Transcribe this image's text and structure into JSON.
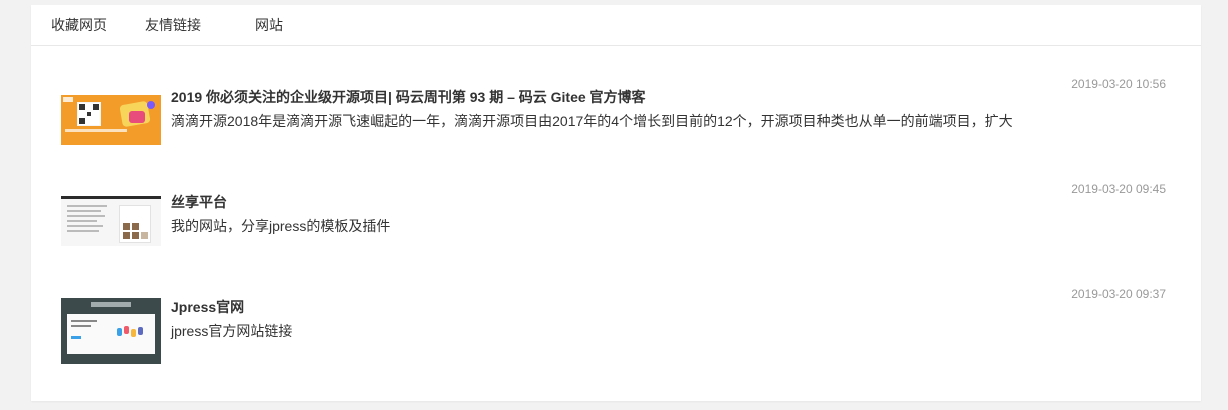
{
  "tabs": [
    {
      "label": "收藏网页"
    },
    {
      "label": "友情链接"
    },
    {
      "label": "网站"
    }
  ],
  "items": [
    {
      "title": "2019 你必须关注的企业级开源项目| 码云周刊第 93 期 – 码云 Gitee 官方博客",
      "description": "滴滴开源2018年是滴滴开源飞速崛起的一年，滴滴开源项目由2017年的4个增长到目前的12个，开源项目种类也从单一的前端项目，扩大",
      "date": "2019-03-20 10:56",
      "thumbnail": "gitee-weekly-banner"
    },
    {
      "title": "丝享平台",
      "description": "我的网站，分享jpress的模板及插件",
      "date": "2019-03-20 09:45",
      "thumbnail": "sixiang-site-screenshot"
    },
    {
      "title": "Jpress官网",
      "description": "jpress官方网站链接",
      "date": "2019-03-20 09:37",
      "thumbnail": "jpress-site-screenshot"
    }
  ],
  "colors": {
    "background": "#f2f2f2",
    "panel": "#ffffff",
    "text": "#333333",
    "date": "#999999"
  }
}
